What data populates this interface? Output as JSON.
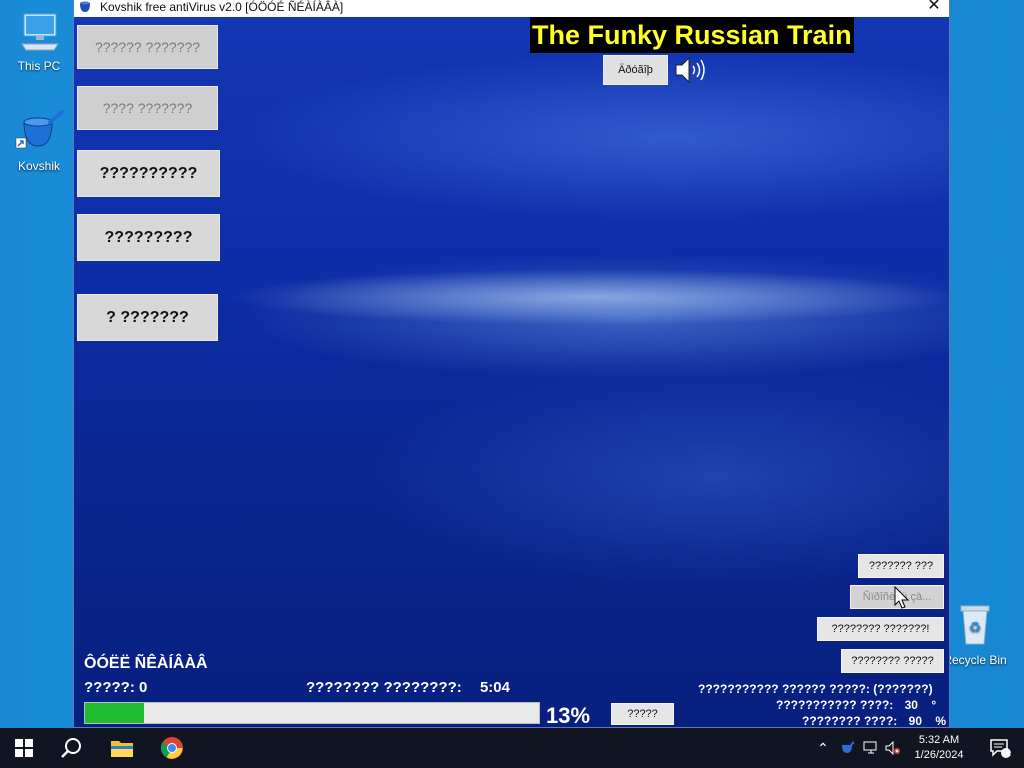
{
  "desktop": {
    "icons": [
      {
        "label": "This PC"
      },
      {
        "label": "Kovshik"
      },
      {
        "label": "Recycle Bin"
      }
    ]
  },
  "window": {
    "title": "Kovshik free antiVirus v2.0 [ÓÖÓÉ ÑÉÀÍÀÂÀ]"
  },
  "menu": {
    "items": [
      {
        "label": "?????? ???????",
        "enabled": false
      },
      {
        "label": "???? ???????",
        "enabled": false
      },
      {
        "label": "??????????",
        "enabled": true
      },
      {
        "label": "?????????",
        "enabled": true
      },
      {
        "label": "? ???????",
        "enabled": true
      }
    ]
  },
  "music": {
    "song_title": "The Funky Russian Train",
    "button_label": "Äðóãîþ",
    "speaker_icon": "speaker-icon"
  },
  "tools": {
    "btn1_label": "??????? ???",
    "btn2_label": "Ñïðîñèòü çà...",
    "btn3_label": "???????? ???????!",
    "btn4_label": "???????? ?????"
  },
  "scan": {
    "status": "ÔÓËË ÑÊÀÍÂÀÂ",
    "threats_label": "?????:",
    "threats_value": "0",
    "elapsed_label": "???????? ????????:",
    "elapsed_value": "5:04",
    "progress_percent": 13,
    "progress_text": "13%",
    "scan_button_label": "?????"
  },
  "info": {
    "line1": "??????????? ?????? ?????: (???????)",
    "line2_label": "??????????? ????:",
    "line2_value": "30",
    "line2_unit": "°",
    "line3_label": "???????? ????:",
    "line3_value": "90",
    "line3_unit": "%"
  },
  "taskbar": {
    "time": "5:32 AM",
    "date": "1/26/2024",
    "notification_count": "3"
  }
}
